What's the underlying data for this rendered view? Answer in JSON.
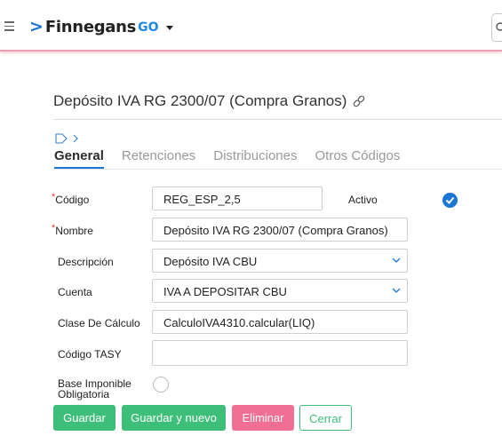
{
  "app": {
    "logo_main": "Finnegans",
    "logo_suffix": "GO"
  },
  "page": {
    "title": "Depósito IVA RG 2300/07 (Compra Granos)"
  },
  "tabs": [
    {
      "label": "General"
    },
    {
      "label": "Retenciones"
    },
    {
      "label": "Distribuciones"
    },
    {
      "label": "Otros Códigos"
    }
  ],
  "form": {
    "codigo": {
      "label": "Código",
      "value": "REG_ESP_2,5",
      "required": true
    },
    "activo": {
      "label": "Activo",
      "checked": true
    },
    "nombre": {
      "label": "Nombre",
      "value": "Depósito IVA RG 2300/07 (Compra Granos)",
      "required": true
    },
    "descripcion": {
      "label": "Descripción",
      "value": "Depósito IVA CBU"
    },
    "cuenta": {
      "label": "Cuenta",
      "value": "IVA A DEPOSITAR CBU"
    },
    "clase": {
      "label": "Clase De Cálculo",
      "value": "CalculoIVA4310.calcular(LIQ)"
    },
    "tasy": {
      "label": "Código TASY",
      "value": ""
    },
    "base": {
      "label_line1": "Base Imponible",
      "label_line2": "Obligatoria",
      "checked": false
    }
  },
  "buttons": {
    "guardar": "Guardar",
    "guardar_nuevo": "Guardar y nuevo",
    "eliminar": "Eliminar",
    "cerrar": "Cerrar"
  },
  "colors": {
    "accent": "#1976d2",
    "save": "#3dbf7a",
    "delete": "#f06f92",
    "topbar_border": "#e8a1b4"
  }
}
